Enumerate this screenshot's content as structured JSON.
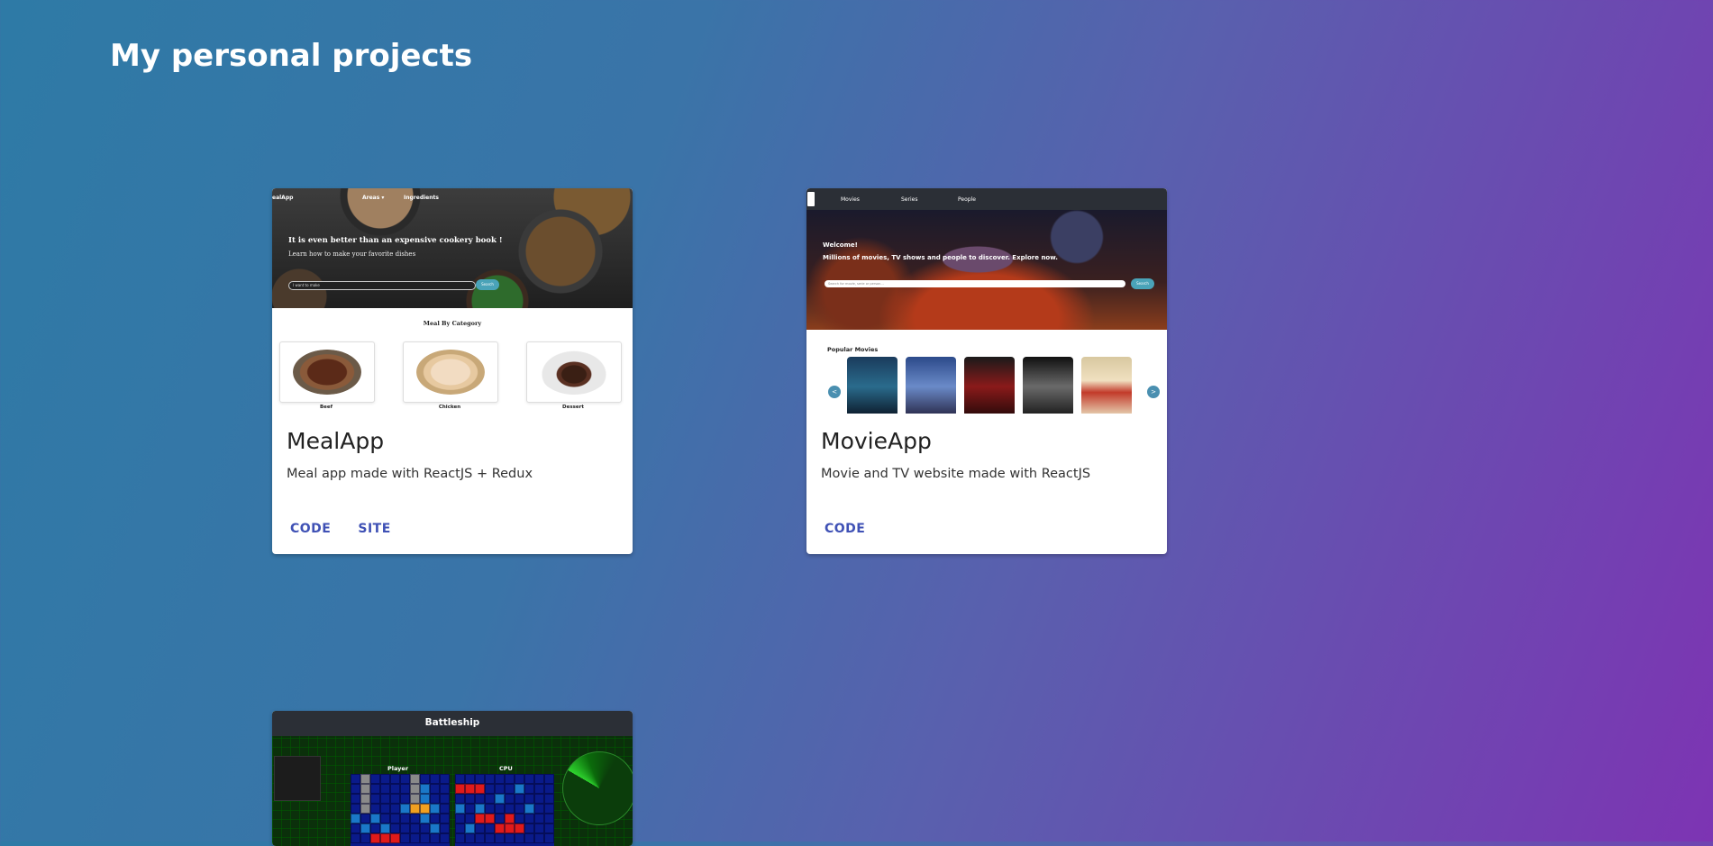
{
  "page": {
    "title": "My personal projects"
  },
  "projects": [
    {
      "title": "MealApp",
      "description": "Meal app made with ReactJS + Redux",
      "actions": [
        "CODE",
        "SITE"
      ],
      "preview": {
        "nav": [
          "ealApp",
          "Areas ▾",
          "Ingredients"
        ],
        "tagline": "It is even better than an expensive cookery book !",
        "subtitle": "Learn how to make your favorite dishes",
        "search_placeholder": "I want to make",
        "search_button": "Search",
        "section_title": "Meal By Category",
        "categories": [
          "Beef",
          "Chicken",
          "Dessert"
        ]
      }
    },
    {
      "title": "MovieApp",
      "description": "Movie and TV website made with ReactJS",
      "actions": [
        "CODE"
      ],
      "preview": {
        "nav": [
          "Movies",
          "Series",
          "People"
        ],
        "welcome": "Welcome!",
        "subtitle": "Millions of movies, TV shows and people to discover. Explore now.",
        "search_placeholder": "Search for movie, serie or person...",
        "search_button": "Search",
        "section_title": "Popular Movies",
        "arrow_prev": "<",
        "arrow_next": ">"
      }
    },
    {
      "title": "Battleship",
      "preview": {
        "header": "Battleship",
        "player_label": "Player",
        "cpu_label": "CPU"
      }
    }
  ]
}
